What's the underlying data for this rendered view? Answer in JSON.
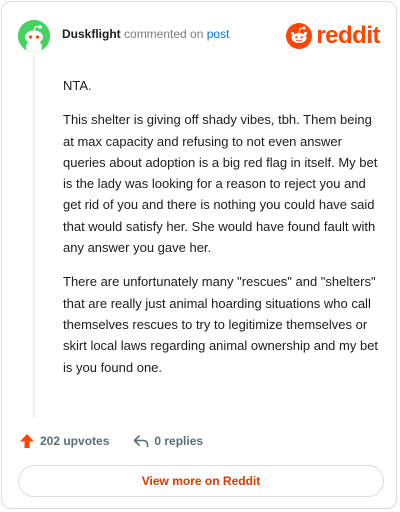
{
  "header": {
    "author": "Duskflight",
    "verb": "commented on",
    "link": "post",
    "logo_word": "reddit"
  },
  "comment": {
    "paragraphs": [
      "NTA.",
      "This shelter is giving off shady vibes, tbh. Them being at max capacity and refusing to not even answer queries about adoption is a big red flag in itself. My bet is the lady was looking for a reason to reject you and get rid of you and there is nothing you could have said that would satisfy her. She would have found fault with any answer you gave her.",
      "There are unfortunately many \"rescues\" and \"shelters\" that are really just animal hoarding situations who call themselves rescues to try to legitimize themselves or skirt local laws regarding animal ownership and my bet is you found one."
    ]
  },
  "actions": {
    "upvotes": "202 upvotes",
    "replies": "0 replies"
  },
  "footer": {
    "more_label": "View more on Reddit"
  },
  "colors": {
    "brand": "#ff4500",
    "avatar_bg": "#46d160",
    "link": "#0079d3",
    "button_text": "#d93a00"
  },
  "icons": [
    "snoo-avatar-icon",
    "reddit-logo-icon",
    "upvote-arrow-icon",
    "reply-arrow-icon"
  ]
}
